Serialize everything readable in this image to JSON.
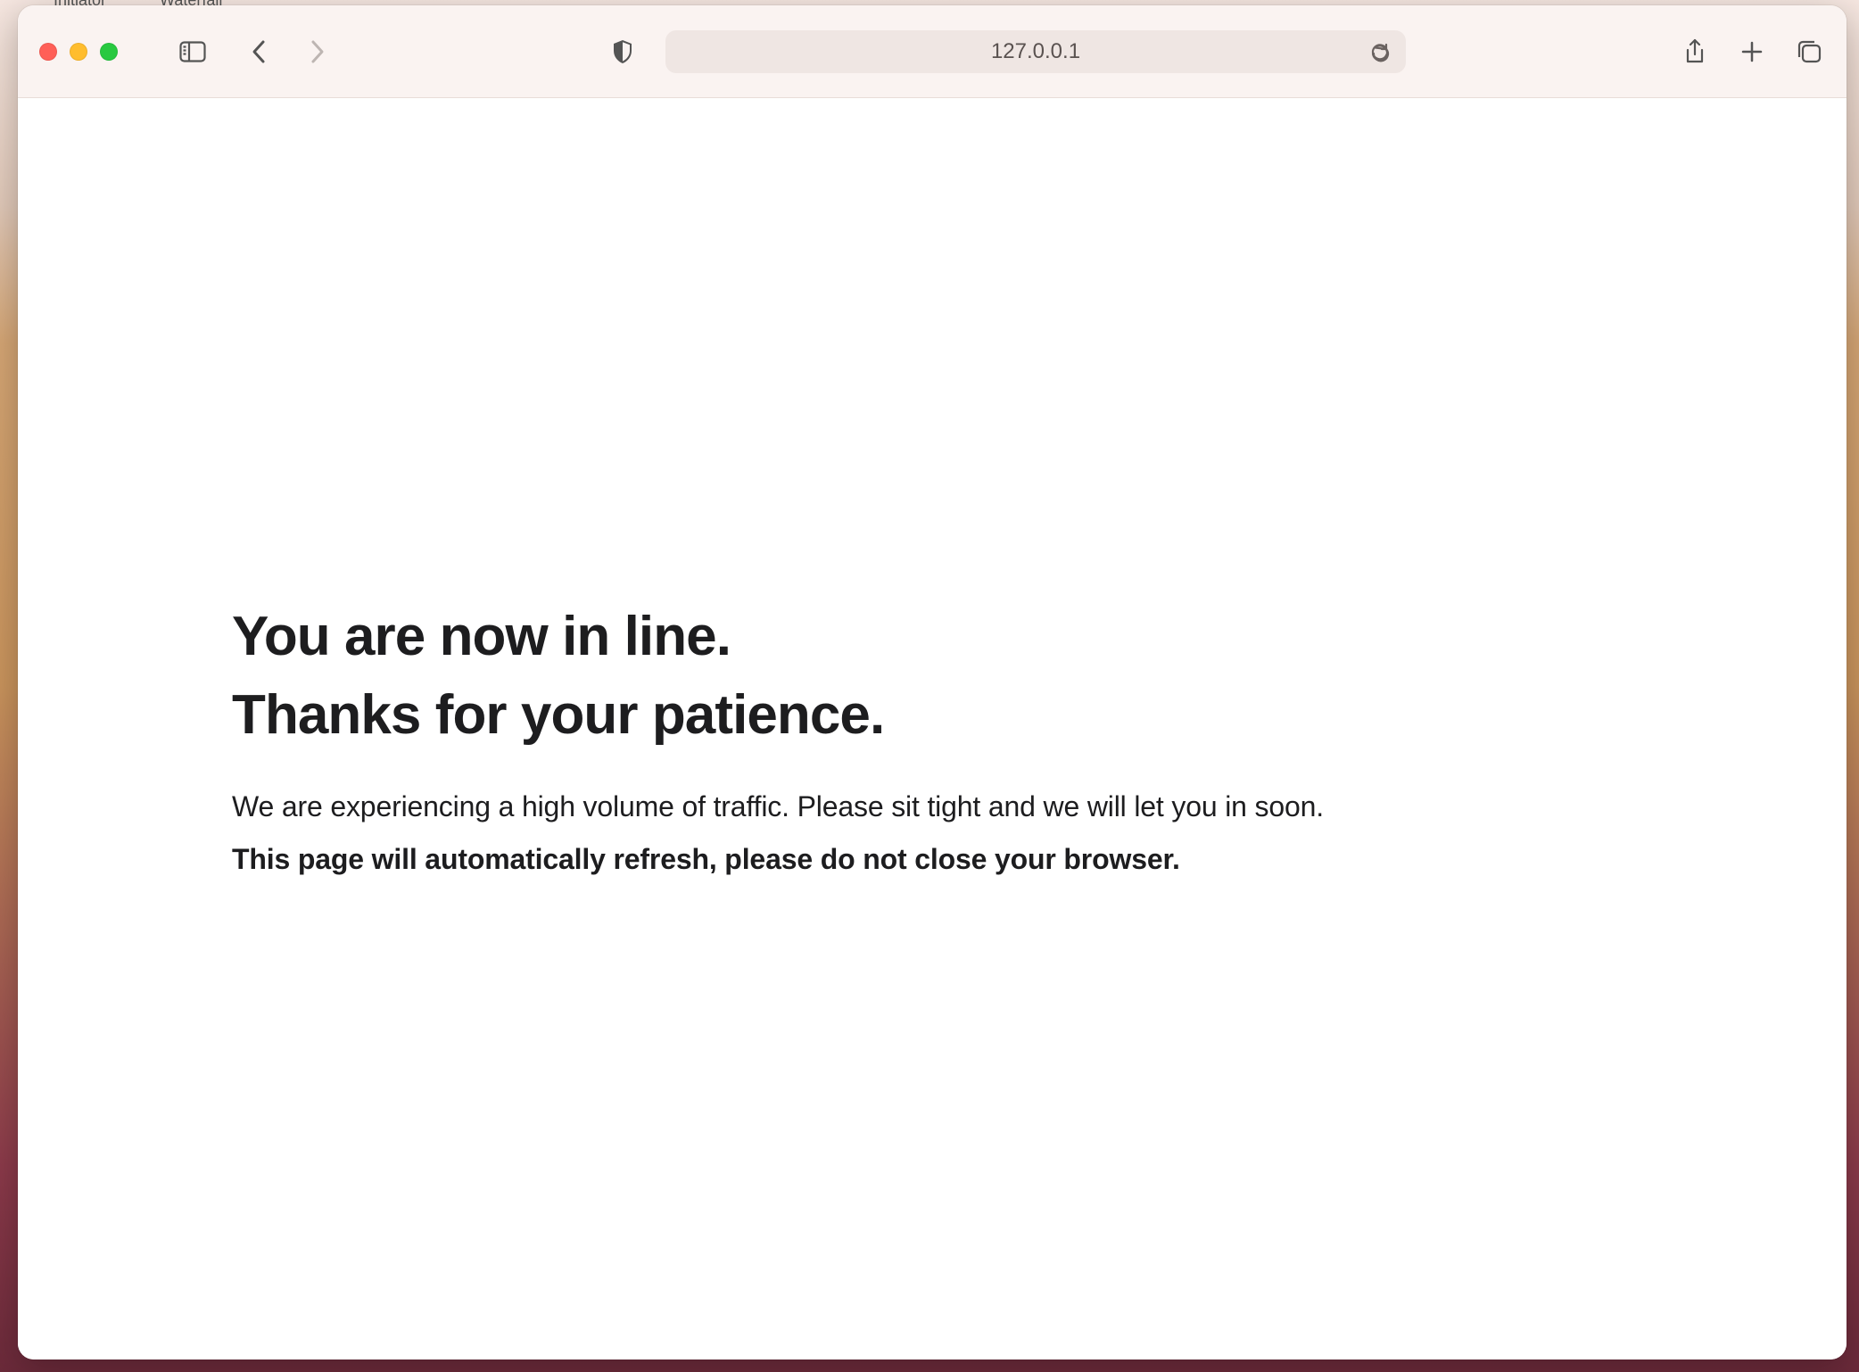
{
  "background": {
    "tabs": [
      "Initiator",
      "Waterfall"
    ]
  },
  "browser": {
    "address": "127.0.0.1"
  },
  "page": {
    "heading_line1": "You are now in line.",
    "heading_line2": "Thanks for your patience.",
    "subtext": "We are experiencing a high volume of traffic. Please sit tight and we will let you in soon.",
    "bold_note": "This page will automatically refresh, please do not close your browser."
  }
}
